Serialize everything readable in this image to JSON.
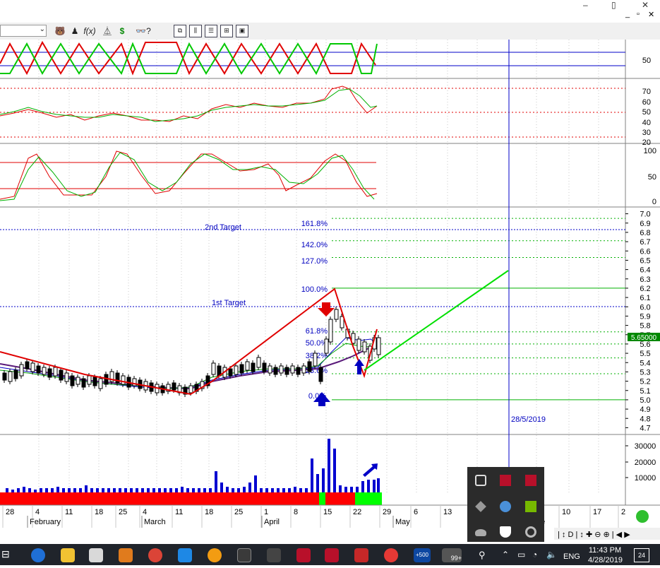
{
  "window": {
    "restore_glyph": "▯",
    "min_glyph": "–",
    "close_glyph": "✕",
    "inner_controls": [
      "_",
      "▫",
      "✕"
    ]
  },
  "toolbar": {
    "symbol_value": "",
    "buttons": [
      "bear-icon",
      "person-icon",
      "fx-icon",
      "tree-icon",
      "dollar-icon",
      "binoculars-help-icon",
      "window-icon",
      "columns-icon",
      "rows-icon",
      "grid-icon",
      "save-icon"
    ],
    "fx_label": "f(x)",
    "dollar_label": "$"
  },
  "panels": {
    "trend": {
      "axis": [
        "50"
      ]
    },
    "rsi": {
      "axis": [
        "70",
        "60",
        "50",
        "40",
        "30",
        "20"
      ]
    },
    "stoch": {
      "axis": [
        "100",
        "50",
        "0"
      ]
    },
    "price": {
      "axis": [
        "7.0",
        "6.9",
        "6.8",
        "6.7",
        "6.6",
        "6.5",
        "6.4",
        "6.3",
        "6.2",
        "6.1",
        "6.0",
        "5.9",
        "5.8",
        "5.7",
        "5.6",
        "5.5",
        "5.4",
        "5.3",
        "5.2",
        "5.1",
        "5.0",
        "4.9",
        "4.8",
        "4.7"
      ],
      "current_price": "5.65000"
    },
    "volume": {
      "axis": [
        "30000",
        "20000",
        "10000"
      ]
    }
  },
  "annotations": {
    "second_target": "2nd Target",
    "first_target": "1st Target",
    "fib_161": "161.8%",
    "fib_142": "142.0%",
    "fib_127": "127.0%",
    "fib_100": "100.0%",
    "fib_61": "61.8%",
    "fib_50": "50.0%",
    "fib_38": "38.2%",
    "fib_23": "23.6%",
    "fib_0": "0.0%",
    "date_marker": "28/5/2019"
  },
  "xaxis": {
    "days": [
      "28",
      "4",
      "11",
      "18",
      "25",
      "4",
      "11",
      "18",
      "25",
      "1",
      "8",
      "15",
      "22",
      "29",
      "6",
      "13",
      "10",
      "17",
      "2"
    ],
    "months": [
      "February",
      "March",
      "April",
      "May",
      "ne"
    ]
  },
  "chart_data": {
    "type": "candlestick",
    "price_axis_range": [
      4.65,
      7.05
    ],
    "fibonacci_levels": [
      {
        "label": "0.0%",
        "price": 5.0
      },
      {
        "label": "23.6%",
        "price": 5.28
      },
      {
        "label": "38.2%",
        "price": 5.45
      },
      {
        "label": "50.0%",
        "price": 5.6
      },
      {
        "label": "61.8%",
        "price": 5.73
      },
      {
        "label": "100.0%",
        "price": 6.2
      },
      {
        "label": "127.0%",
        "price": 6.53
      },
      {
        "label": "142.0%",
        "price": 6.71
      },
      {
        "label": "161.8%",
        "price": 6.95
      }
    ],
    "targets": [
      {
        "label": "1st Target",
        "price": 6.0
      },
      {
        "label": "2nd Target",
        "price": 6.9
      }
    ],
    "current_price": 5.65,
    "volume_axis_ticks": [
      10000,
      20000,
      30000
    ]
  },
  "taskbar": {
    "time": "11:43 PM",
    "date": "4/28/2019",
    "language": "ENG",
    "badge_99": "99+",
    "badge_500": "+500",
    "notif_count": "24"
  },
  "colors": {
    "red": "#e00000",
    "green": "#00c800",
    "blue": "#0000c0",
    "bear_fill": "#ff0000",
    "bull_fill": "#00ff00"
  }
}
